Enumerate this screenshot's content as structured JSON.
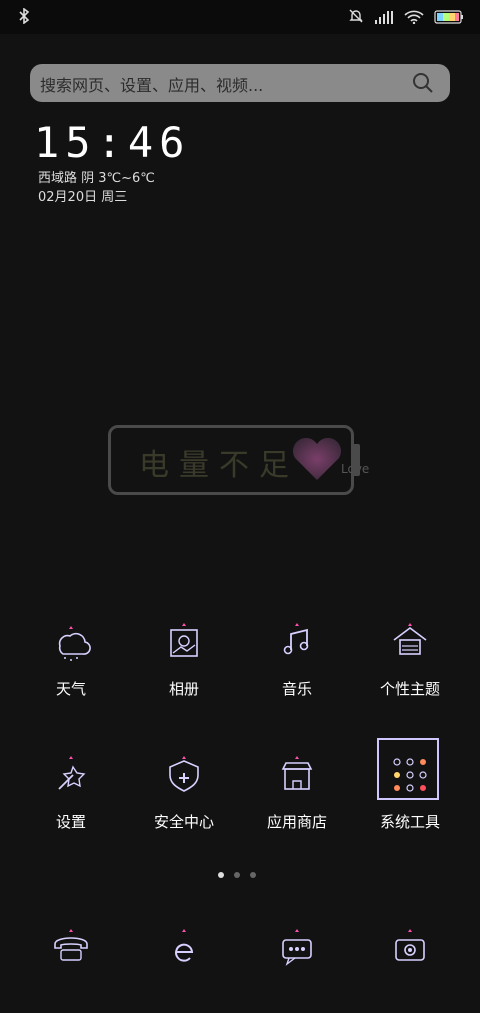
{
  "status_bar": {
    "battery_level": "high"
  },
  "search": {
    "placeholder": "搜索网页、设置、应用、视频..."
  },
  "clock": {
    "time": "15:46",
    "weather_line": "西域路  阴  3℃~6℃",
    "date_line": "02月20日 周三"
  },
  "battery_widget": {
    "text": "电量不足",
    "love": "Love"
  },
  "apps": [
    {
      "label": "天气",
      "icon": "weather-icon"
    },
    {
      "label": "相册",
      "icon": "gallery-icon"
    },
    {
      "label": "音乐",
      "icon": "music-icon"
    },
    {
      "label": "个性主题",
      "icon": "theme-icon"
    },
    {
      "label": "设置",
      "icon": "settings-icon"
    },
    {
      "label": "安全中心",
      "icon": "security-icon"
    },
    {
      "label": "应用商店",
      "icon": "app-store-icon"
    },
    {
      "label": "系统工具",
      "icon": "system-tools-icon"
    }
  ],
  "page_indicator": {
    "count": 3,
    "active": 1
  },
  "dock": [
    {
      "icon": "phone-icon"
    },
    {
      "icon": "browser-icon"
    },
    {
      "icon": "messages-icon"
    },
    {
      "icon": "camera-icon"
    }
  ],
  "colors": {
    "background": "#121212",
    "icon_stroke": "#d8d0ff",
    "accent_pink": "#ff4fb0"
  }
}
